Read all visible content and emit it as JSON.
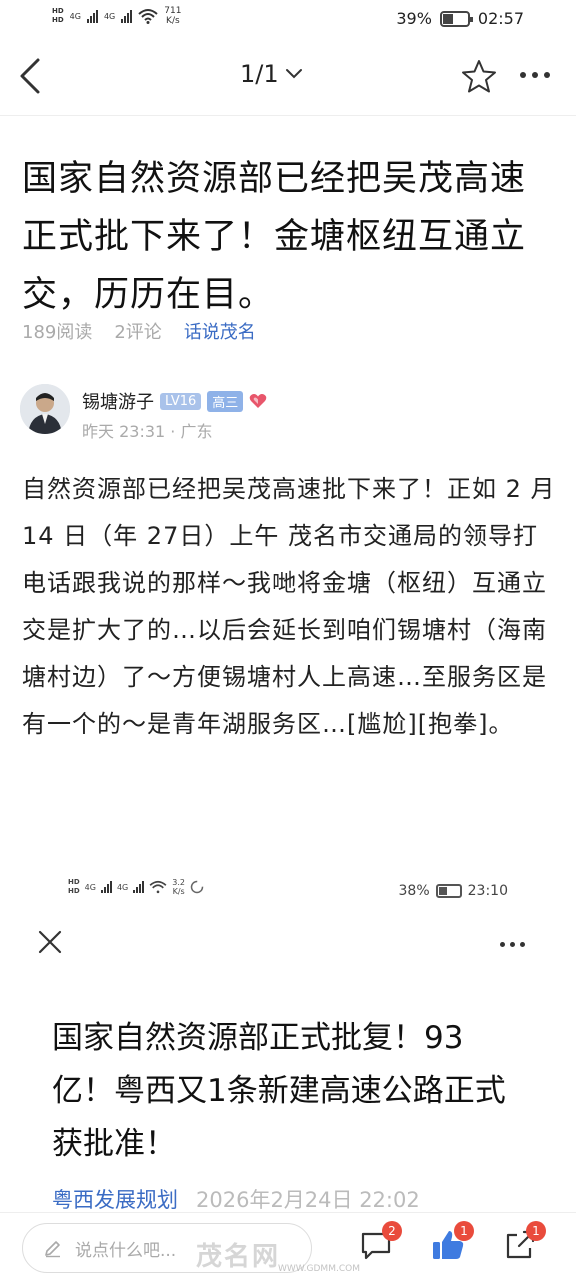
{
  "status_bar": {
    "network_speed_value": "711",
    "network_speed_unit": "K/s",
    "battery_percent": "39%",
    "battery_level": 0.39,
    "time": "02:57"
  },
  "nav": {
    "page_indicator": "1/1"
  },
  "article": {
    "title": "国家自然资源部已经把吴茂高速正式批下来了！金塘枢纽互通立交，历历在目。",
    "reads": "189阅读",
    "comments": "2评论",
    "topic": "话说茂名",
    "author": {
      "name": "锡塘游子",
      "level": "LV16",
      "grade": "高三",
      "posted": "昨天 23:31 · 广东"
    },
    "body": "自然资源部已经把吴茂高速批下来了！正如 2 月 14 日（年 27日）上午 茂名市交通局的领导打电话跟我说的那样～我哋将金塘（枢纽）互通立交是扩大了的…以后会延长到咱们锡塘村（海南塘村边）了～方便锡塘村人上高速…至服务区是有一个的～是青年湖服务区…[尴尬][抱拳]。"
  },
  "embedded_screenshot": {
    "network_speed_value": "3.2",
    "network_speed_unit": "K/s",
    "battery_percent": "38%",
    "battery_level": 0.38,
    "time": "23:10",
    "title": "国家自然资源部正式批复！93亿！粤西又1条新建高速公路正式获批准！",
    "source": "粤西发展规划",
    "datetime": "2026年2月24日 22:02"
  },
  "bottom_bar": {
    "comment_placeholder": "说点什么吧...",
    "comment_count": "2",
    "like_count": "1",
    "share_count": "1"
  },
  "watermark": {
    "text": "茂名网",
    "url": "WWW.GDMM.COM"
  },
  "colors": {
    "link_blue": "#3b6cc4",
    "badge_red": "#e94b3c",
    "like_blue": "#3f7be0"
  }
}
